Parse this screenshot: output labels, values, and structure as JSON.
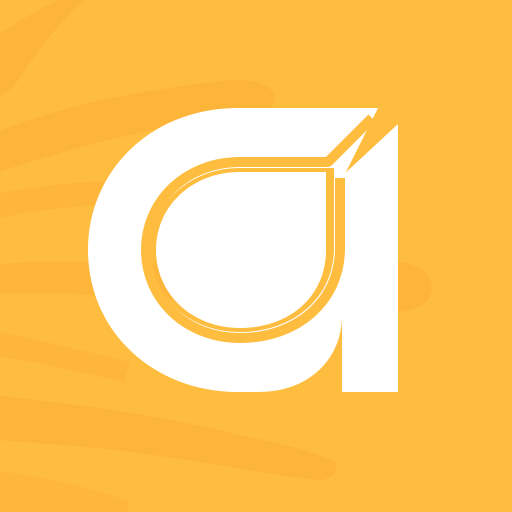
{
  "app_icon": {
    "icon": "letter-a-logo-icon",
    "colors": {
      "background": "#FFBD3F",
      "brush_strokes": "#FCAE35",
      "glyph": "#FFFFFF"
    }
  }
}
